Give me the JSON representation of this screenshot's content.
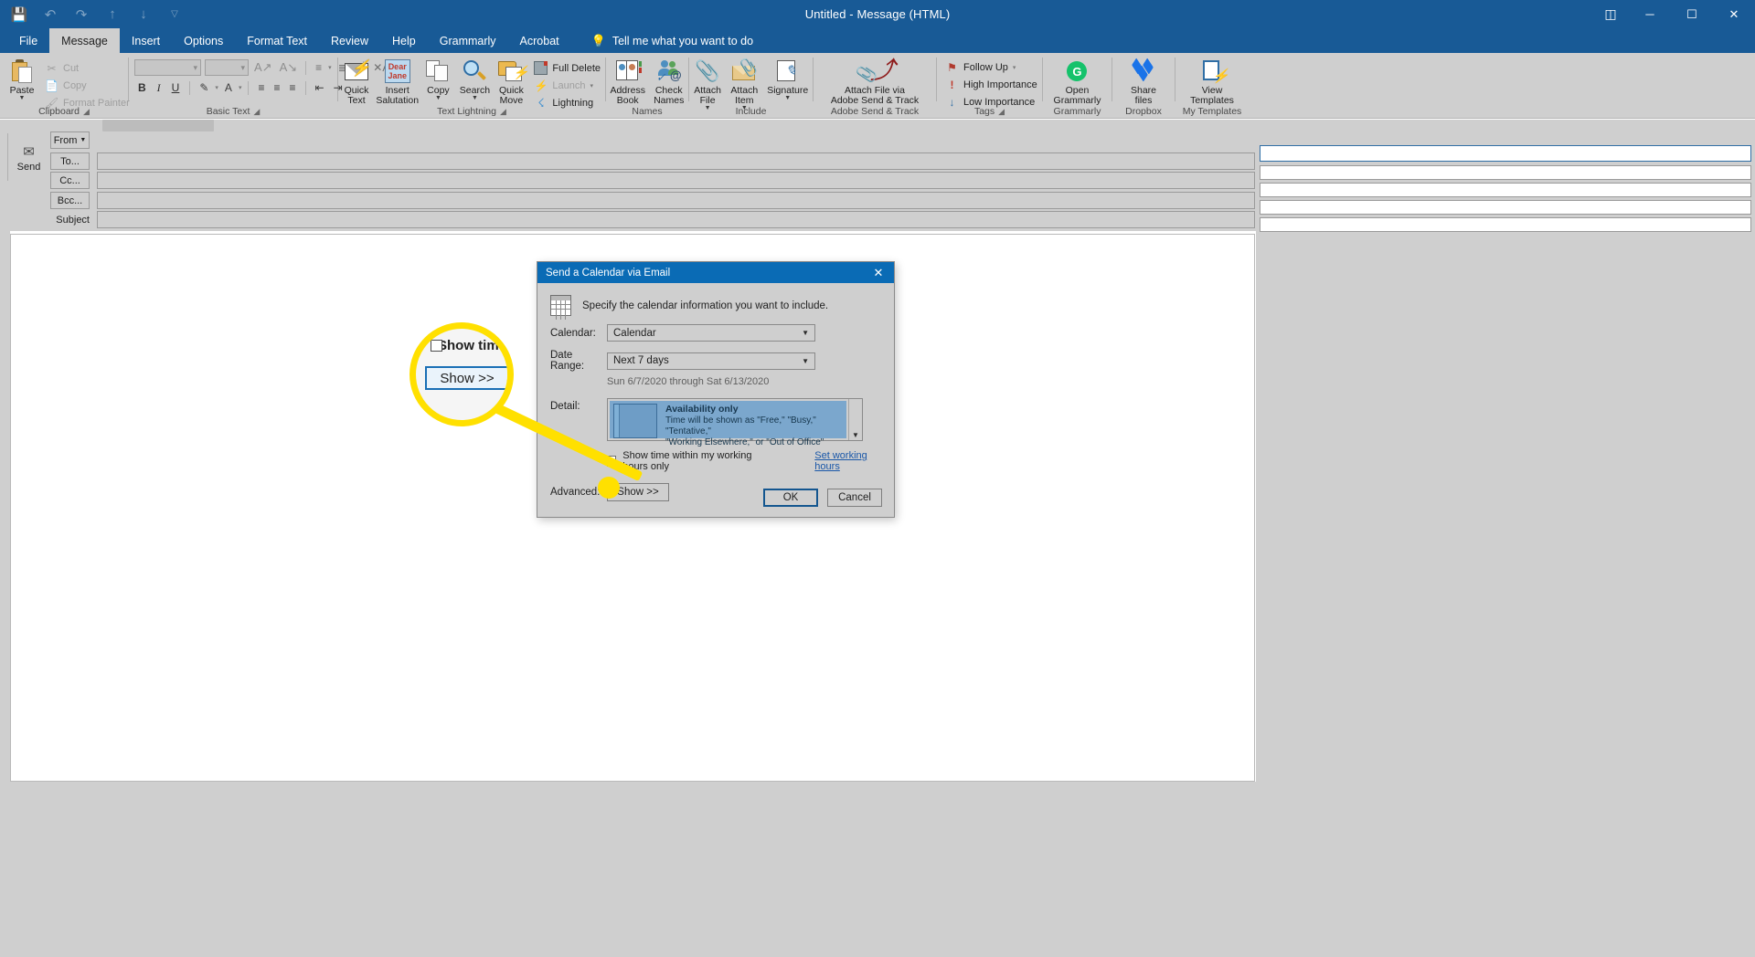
{
  "window": {
    "title": "Untitled  -  Message (HTML)",
    "quick_access": [
      "save-icon",
      "undo-icon",
      "redo-icon",
      "up-icon",
      "down-icon",
      "customize-qat-icon"
    ],
    "controls": {
      "ribbon_display": "ribbon-display-options-icon",
      "minimize": "─",
      "maximize": "☐",
      "close": "✕"
    }
  },
  "tabs": [
    {
      "label": "File",
      "active": false
    },
    {
      "label": "Message",
      "active": true
    },
    {
      "label": "Insert",
      "active": false
    },
    {
      "label": "Options",
      "active": false
    },
    {
      "label": "Format Text",
      "active": false
    },
    {
      "label": "Review",
      "active": false
    },
    {
      "label": "Help",
      "active": false
    },
    {
      "label": "Grammarly",
      "active": false
    },
    {
      "label": "Acrobat",
      "active": false
    }
  ],
  "tell_me": {
    "label": "Tell me what you want to do",
    "icon": "lightbulb-icon"
  },
  "ribbon": {
    "groups": [
      {
        "label": "Clipboard",
        "has_dialog_launcher": true
      },
      {
        "label": "Basic Text",
        "has_dialog_launcher": true
      },
      {
        "label": "Text Lightning",
        "has_dialog_launcher": true
      },
      {
        "label": "Names",
        "has_dialog_launcher": false
      },
      {
        "label": "Include",
        "has_dialog_launcher": false
      },
      {
        "label": "Adobe Send & Track",
        "has_dialog_launcher": false
      },
      {
        "label": "Tags",
        "has_dialog_launcher": true
      },
      {
        "label": "Grammarly",
        "has_dialog_launcher": false
      },
      {
        "label": "Dropbox",
        "has_dialog_launcher": false
      },
      {
        "label": "My Templates",
        "has_dialog_launcher": false
      }
    ],
    "clipboard": {
      "paste": "Paste",
      "cut": "Cut",
      "copy": "Copy",
      "format_painter": "Format Painter"
    },
    "basic_text": {
      "font_name": "",
      "font_size": "",
      "grow_font": "A",
      "shrink_font": "A",
      "bold": "B",
      "italic": "I",
      "underline": "U"
    },
    "text_lightning": {
      "quick_text": "Quick\nText",
      "insert_salutation": "Insert\nSalutation",
      "dear_jane_line1": "Dear",
      "dear_jane_line2": "Jane",
      "copy": "Copy",
      "search": "Search",
      "quick_move": "Quick\nMove",
      "full_delete": "Full Delete",
      "launch": "Launch",
      "lightning": "Lightning"
    },
    "names": {
      "address_book": "Address\nBook",
      "check_names": "Check\nNames"
    },
    "include": {
      "attach_file": "Attach\nFile",
      "attach_item": "Attach\nItem",
      "signature": "Signature"
    },
    "adobe": {
      "attach_via": "Attach File via\nAdobe Send & Track"
    },
    "tags": {
      "follow_up": "Follow Up",
      "high_importance": "High Importance",
      "low_importance": "Low Importance"
    },
    "grammarly": {
      "open": "Open\nGrammarly"
    },
    "dropbox": {
      "share": "Share\nfiles"
    },
    "my_templates": {
      "view": "View\nTemplates"
    }
  },
  "compose": {
    "send_button": "Send",
    "from_label": "From",
    "to_label": "To...",
    "cc_label": "Cc...",
    "bcc_label": "Bcc...",
    "subject_label": "Subject",
    "from_value": "",
    "to_value": "",
    "cc_value": "",
    "bcc_value": "",
    "subject_value": ""
  },
  "dialog": {
    "title": "Send a Calendar via Email",
    "close_glyph": "✕",
    "intro": "Specify the calendar information you want to include.",
    "calendar_label": "Calendar:",
    "calendar_value": "Calendar",
    "date_range_label": "Date Range:",
    "date_range_value": "Next 7 days",
    "date_range_hint": "Sun 6/7/2020 through Sat 6/13/2020",
    "detail_label": "Detail:",
    "detail_title": "Availability only",
    "detail_desc_line1": "Time will be shown as \"Free,\" \"Busy,\" \"Tentative,\"",
    "detail_desc_line2": "\"Working Elsewhere,\" or \"Out of Office\"",
    "working_hours_checkbox": "Show time within my working hours only",
    "working_hours_link": "Set working hours",
    "advanced_label": "Advanced:",
    "show_button": "Show >>",
    "ok_button": "OK",
    "cancel_button": "Cancel"
  },
  "callout": {
    "zoom_checkbox_text": "Show time",
    "zoom_button_text": "Show >>",
    "highlight_color": "#ffe000"
  },
  "colors": {
    "title_bar": "#185a96",
    "ribbon_bg": "#cfcfcf",
    "dialog_title": "#0a6bb5",
    "accent_blue": "#2f6ea5",
    "link": "#1a57a8"
  }
}
